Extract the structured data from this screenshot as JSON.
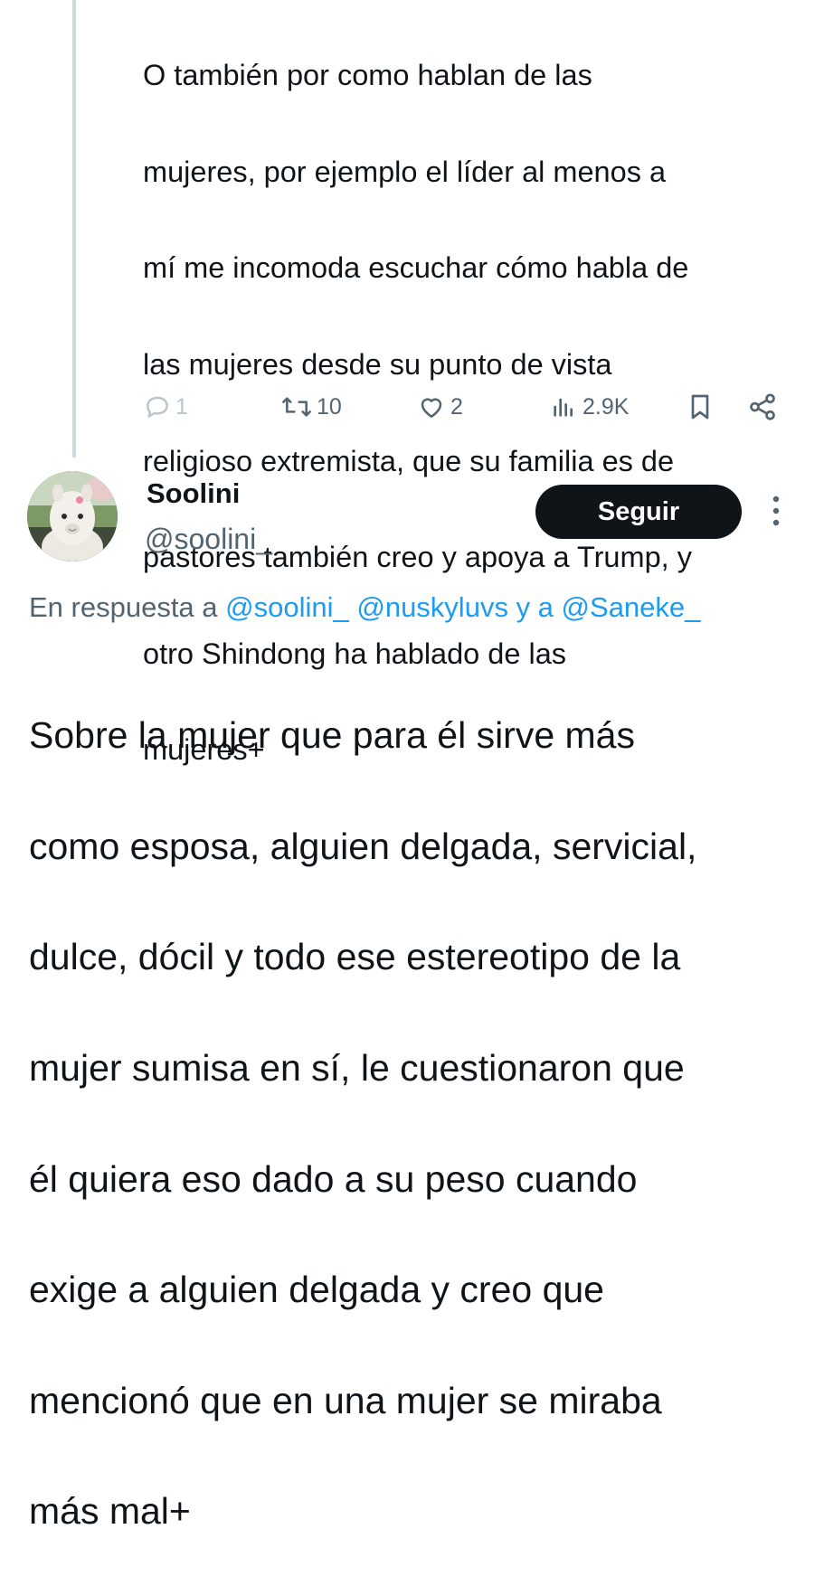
{
  "previous_tweet": {
    "text_lines": [
      "O también por como hablan de las",
      "mujeres, por ejemplo el líder al menos a",
      "mí me incomoda escuchar cómo habla de",
      "las mujeres desde su punto de vista",
      "religioso extremista, que su familia es de",
      "pastores también creo y apoya a Trump, y",
      "otro Shindong ha hablado de las",
      "mujeres+"
    ],
    "actions": {
      "reply_count": "1",
      "retweet_count": "10",
      "like_count": "2",
      "views_count": "2.9K"
    }
  },
  "tweet": {
    "author": {
      "display_name": "Soolini",
      "handle": "@soolini_"
    },
    "follow_label": "Seguir",
    "reply_to": {
      "prefix": "En respuesta a ",
      "mention_1": "@soolini_",
      "mention_2": "@nuskyluvs",
      "connector": " y a ",
      "mention_3": "@Saneke_"
    },
    "text_lines": [
      "Sobre la mujer que para él sirve más",
      "como esposa, alguien delgada, servicial,",
      "dulce, dócil y todo ese estereotipo de la",
      "mujer sumisa en sí, le cuestionaron que",
      "él quiera eso dado a su peso cuando",
      "exige a alguien delgada y creo que",
      "mencionó que en una mujer se miraba",
      "más mal+"
    ]
  },
  "icons": [
    "reply-icon",
    "retweet-icon",
    "like-icon",
    "views-icon",
    "bookmark-icon",
    "share-icon",
    "more-icon"
  ],
  "colors": {
    "text": "#0f1419",
    "secondary": "#536471",
    "link": "#1d9bf0",
    "thread_line": "#cfd9de",
    "button_bg": "#0f1419"
  }
}
